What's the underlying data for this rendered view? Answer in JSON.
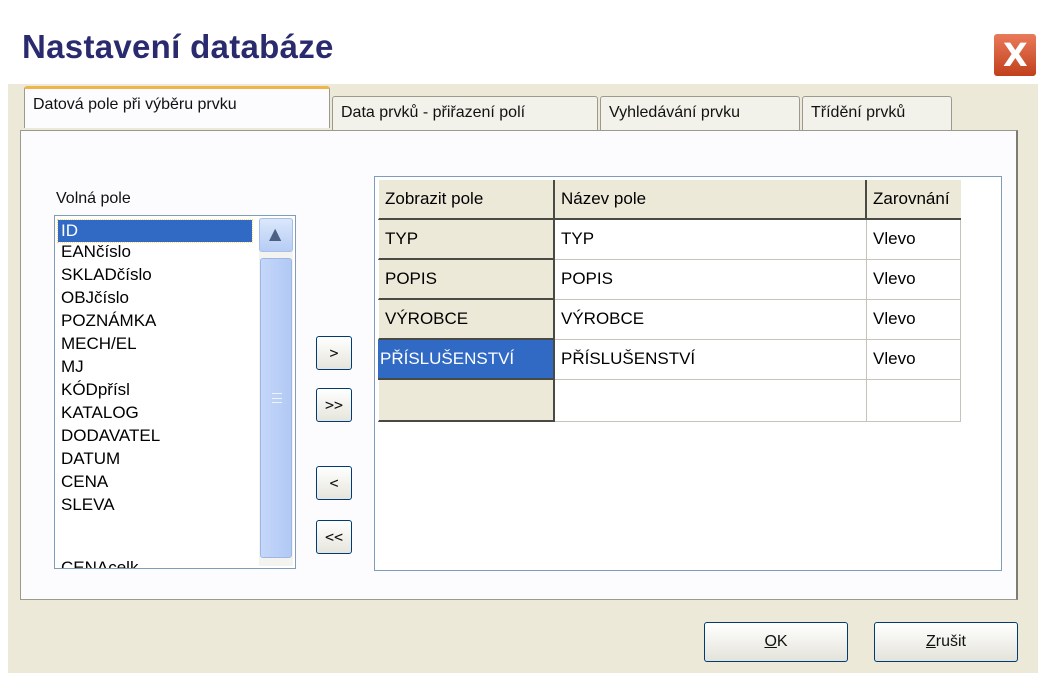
{
  "window": {
    "title": "Nastavení databáze",
    "close_glyph": "X"
  },
  "tabs": [
    {
      "label": "Datová pole při výběru prvku",
      "active": true
    },
    {
      "label": "Data prvků - přiřazení polí",
      "active": false
    },
    {
      "label": "Vyhledávání prvku",
      "active": false
    },
    {
      "label": "Třídění prvků",
      "active": false
    }
  ],
  "free_fields": {
    "label": "Volná pole",
    "items": [
      "ID",
      "EANčíslo",
      "SKLADčíslo",
      "OBJčíslo",
      "POZNÁMKA",
      "MECH/EL",
      "MJ",
      "KÓDpřísl",
      "KATALOG",
      "DODAVATEL",
      "DATUM",
      "CENA",
      "SLEVA",
      "CENAcelk"
    ],
    "selected": "ID",
    "scroll_up_glyph": "▲"
  },
  "move_buttons": {
    "add": ">",
    "add_all": ">>",
    "remove": "<",
    "remove_all": "<<"
  },
  "grid": {
    "headers": [
      "Zobrazit pole",
      "Název pole",
      "Zarovnání"
    ],
    "rows": [
      [
        "TYP",
        "TYP",
        "Vlevo"
      ],
      [
        "POPIS",
        "POPIS",
        "Vlevo"
      ],
      [
        "VÝROBCE",
        "VÝROBCE",
        "Vlevo"
      ],
      [
        "PŘÍSLUŠENSTVÍ",
        "PŘÍSLUŠENSTVÍ",
        "Vlevo"
      ],
      [
        "",
        "",
        ""
      ]
    ],
    "selected_row": 3
  },
  "buttons": {
    "ok_mnemonic": "O",
    "ok_rest": "K",
    "cancel_mnemonic": "Z",
    "cancel_rest": "rušit"
  },
  "colors": {
    "selection": "#316ac5",
    "dialog_bg": "#ece9d8",
    "title_text": "#2a2a6e",
    "close_button": "#c1401c"
  }
}
